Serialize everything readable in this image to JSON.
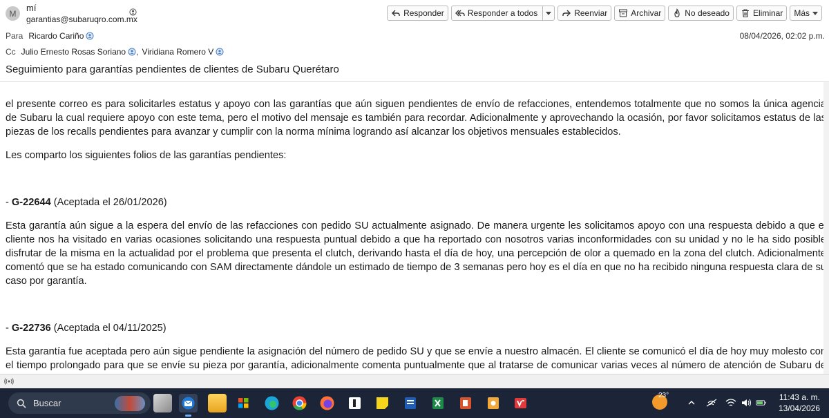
{
  "sender": {
    "avatar_initial": "M",
    "name": "mí",
    "email": "garantias@subaruqro.com.mx"
  },
  "toolbar": {
    "reply": "Responder",
    "reply_all": "Responder a todos",
    "forward": "Reenviar",
    "archive": "Archivar",
    "junk": "No deseado",
    "delete": "Eliminar",
    "more": "Más"
  },
  "to": {
    "label": "Para",
    "recipients": [
      "Ricardo Cariño"
    ]
  },
  "cc": {
    "label": "Cc",
    "recipients": [
      "Julio Ernesto Rosas Soriano",
      "Viridiana Romero V"
    ]
  },
  "date": "08/04/2026, 02:02 p.m.",
  "subject": "Seguimiento para garantías pendientes de clientes de Subaru Querétaro",
  "body": {
    "intro": "el presente correo es para solicitarles estatus y apoyo con las garantías que aún siguen pendientes de envío de refacciones, entendemos totalmente que no somos la única agencia de Subaru la cual requiere apoyo con este tema, pero el motivo del mensaje es también para recordar. Adicionalmente y aprovechando la ocasión, por favor solicitamos estatus de las piezas de los recalls pendientes para avanzar y cumplir con la norma mínima logrando así alcanzar los objetivos mensuales establecidos.",
    "list_intro": "Les comparto los siguientes folios de las garantías pendientes:",
    "items": [
      {
        "prefix": "- ",
        "folio": "G-22644",
        "accepted": " (Aceptada el 26/01/2026)",
        "text": "Esta garantía aún sigue a la espera del envío de las refacciones con pedido SU actualmente asignado. De manera urgente les solicitamos apoyo con una respuesta debido a que el cliente nos ha visitado en varias ocasiones solicitando una respuesta puntual debido a que ha reportado con nosotros varias inconformidades con su unidad y no le ha sido posible disfrutar de la misma en la actualidad por el problema que presenta el clutch, derivando hasta el día de hoy, una percepción de olor a quemado en la zona del clutch. Adicionalmente comentó que se ha estado comunicando con SAM directamente dándole un estimado de tiempo de 3 semanas pero hoy es el día en que no ha recibido ninguna respuesta clara de su caso por garantía."
      },
      {
        "prefix": "- ",
        "folio": "G-22736",
        "accepted": " (Aceptada el 04/11/2025)",
        "text": "Esta garantía fue aceptada pero aún sigue pendiente la asignación del número de pedido SU y que se envíe a nuestro almacén. El cliente se comunicó el día de hoy muy molesto con el tiempo prolongado para que se envíe su pieza por garantía, adicionalmente comenta puntualmente que al tratarse de comunicar varias veces al número de atención de Subaru de México no le han dado respuesta telefónica ni por correo."
      }
    ]
  },
  "taskbar": {
    "search_placeholder": "Buscar",
    "weather_temp": "23°",
    "time": "11:43 a. m.",
    "date": "13/04/2026",
    "accent": "#6fb0ff"
  }
}
